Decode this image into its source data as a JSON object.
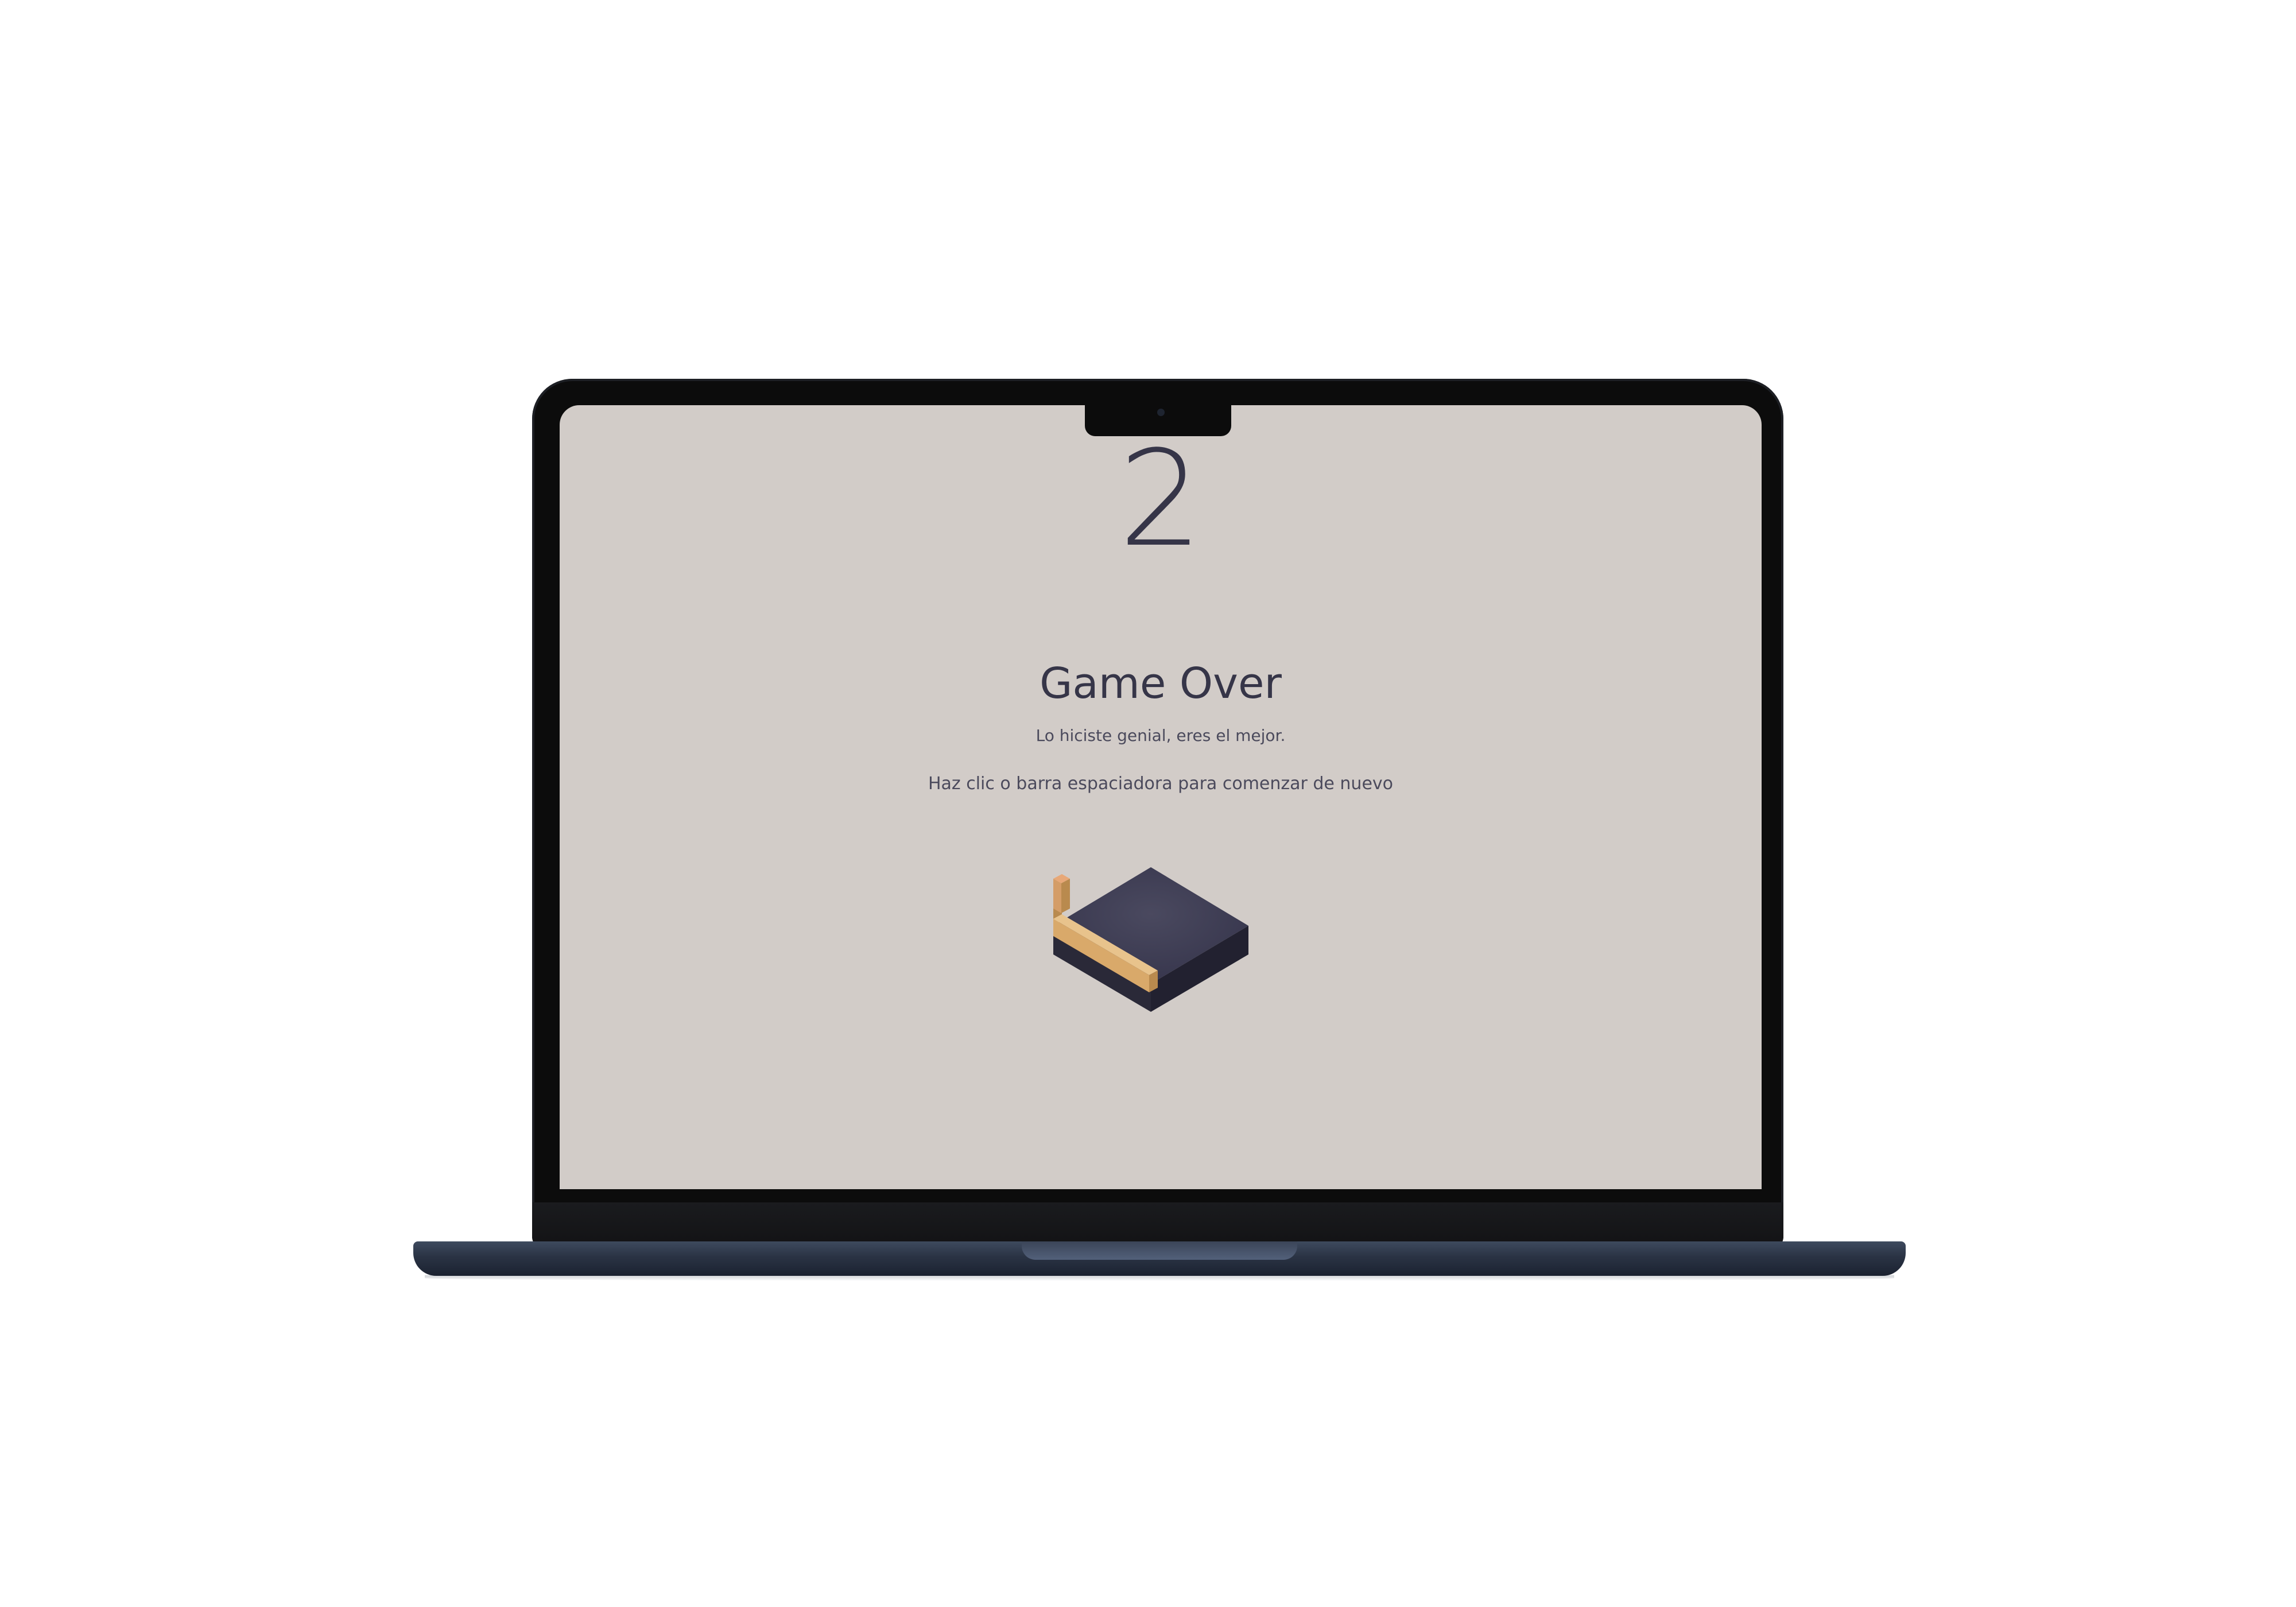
{
  "game": {
    "score": "2",
    "title": "Game Over",
    "subtitle": "Lo hiciste genial, eres el mejor.",
    "hint": "Haz clic o barra espaciadora para comenzar de nuevo"
  },
  "colors": {
    "screen_background": "#d2ccc8",
    "text_dark": "#363548",
    "platform_top": "#3c3b50",
    "platform_left": "#2a2938",
    "platform_right": "#222130",
    "stick_top": "#e8c38c",
    "stick_front": "#d9a96a",
    "stick_side": "#b98a4e",
    "laptop_bezel": "#0c0c0c",
    "laptop_base": "#2a3344"
  },
  "icons": {
    "platform": "isometric-platform-block",
    "stick": "fallen-stick-icon"
  }
}
